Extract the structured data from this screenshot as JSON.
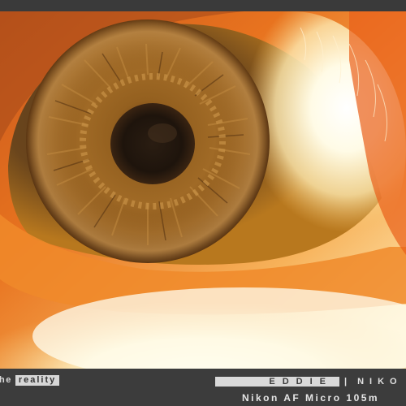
{
  "photo": {
    "subject_icon": "eye-macro-icon",
    "colors": {
      "iris": "#8a5518",
      "pupil": "#1e140c",
      "skin": "#e96a1a",
      "highlight": "#fffbe8",
      "frame": "#3b3b3b"
    }
  },
  "caption": {
    "left_prefix": "he",
    "left_highlight": "reality",
    "name": "EDDIE",
    "separator": "|",
    "brand": "NIKO",
    "lens": "Nikon AF Micro 105m"
  }
}
